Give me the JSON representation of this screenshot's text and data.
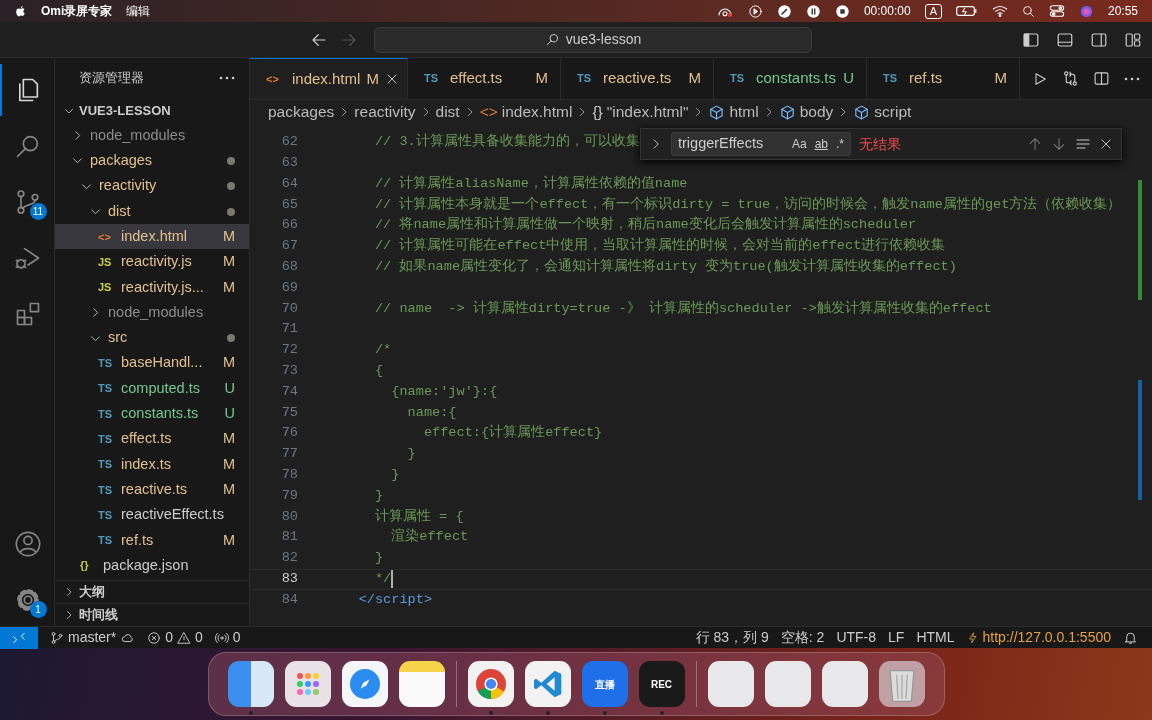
{
  "menubar": {
    "app": "Omi录屏专家",
    "menus": [
      "编辑"
    ],
    "timer": "00:00:00",
    "input_method": "A",
    "clock": "20:55"
  },
  "titlebar": {
    "search": "vue3-lesson"
  },
  "activity_bar": [
    {
      "kind": "explorer",
      "selected": true
    },
    {
      "kind": "search",
      "selected": false
    },
    {
      "kind": "scm",
      "selected": false,
      "badge": "11"
    },
    {
      "kind": "debug",
      "selected": false
    },
    {
      "kind": "extensions",
      "selected": false
    }
  ],
  "activity_bottom": [
    {
      "kind": "account"
    },
    {
      "kind": "settings",
      "badge": "1"
    }
  ],
  "sidebar": {
    "title": "资源管理器",
    "root": {
      "name": "VUE3-LESSON",
      "expanded": true
    },
    "tree": [
      {
        "name": "node_modules",
        "kind": "folder",
        "expanded": false,
        "ignored": true,
        "selected": false
      },
      {
        "name": "packages",
        "kind": "folder",
        "expanded": true,
        "dot": true,
        "selected": false,
        "children": [
          {
            "name": "reactivity",
            "kind": "folder",
            "expanded": true,
            "dot": true,
            "selected": false,
            "children": [
              {
                "name": "dist",
                "kind": "folder",
                "expanded": true,
                "dot": true,
                "selected": false,
                "children": [
                  {
                    "name": "index.html",
                    "kind": "html",
                    "icon": "<>",
                    "badge": "M",
                    "selected": true
                  },
                  {
                    "name": "reactivity.js",
                    "kind": "js",
                    "icon": "JS",
                    "badge": "M",
                    "selected": false
                  },
                  {
                    "name": "reactivity.js...",
                    "kind": "js",
                    "icon": "JS",
                    "badge": "M",
                    "selected": false
                  }
                ]
              },
              {
                "name": "node_modules",
                "kind": "folder",
                "expanded": false,
                "ignored": true,
                "selected": false
              },
              {
                "name": "src",
                "kind": "folder",
                "expanded": true,
                "dot": true,
                "selected": false,
                "children": [
                  {
                    "name": "baseHandl...",
                    "kind": "ts",
                    "icon": "TS",
                    "badge": "M",
                    "selected": false
                  },
                  {
                    "name": "computed.ts",
                    "kind": "ts",
                    "icon": "TS",
                    "badge": "U",
                    "selected": false
                  },
                  {
                    "name": "constants.ts",
                    "kind": "ts",
                    "icon": "TS",
                    "badge": "U",
                    "selected": false
                  },
                  {
                    "name": "effect.ts",
                    "kind": "ts",
                    "icon": "TS",
                    "badge": "M",
                    "selected": false
                  },
                  {
                    "name": "index.ts",
                    "kind": "ts",
                    "icon": "TS",
                    "badge": "M",
                    "selected": false
                  },
                  {
                    "name": "reactive.ts",
                    "kind": "ts",
                    "icon": "TS",
                    "badge": "M",
                    "selected": false
                  },
                  {
                    "name": "reactiveEffect.ts",
                    "kind": "ts",
                    "icon": "TS",
                    "selected": false
                  },
                  {
                    "name": "ref.ts",
                    "kind": "ts",
                    "icon": "TS",
                    "badge": "M",
                    "selected": false
                  }
                ]
              }
            ]
          },
          {
            "name": "package.json",
            "kind": "json",
            "icon": "{}",
            "selected": false
          }
        ]
      }
    ],
    "sections": [
      {
        "name": "大纲",
        "expanded": false
      },
      {
        "name": "时间线",
        "expanded": false
      }
    ]
  },
  "tabs": [
    {
      "name": "index.html",
      "kind": "html",
      "icon": "<>",
      "badge": "M",
      "selected": true
    },
    {
      "name": "effect.ts",
      "kind": "ts",
      "icon": "TS",
      "badge": "M",
      "selected": false
    },
    {
      "name": "reactive.ts",
      "kind": "ts",
      "icon": "TS",
      "badge": "M",
      "selected": false
    },
    {
      "name": "constants.ts",
      "kind": "ts",
      "icon": "TS",
      "badge": "U",
      "selected": false
    },
    {
      "name": "ref.ts",
      "kind": "ts",
      "icon": "TS",
      "badge": "M",
      "selected": false
    }
  ],
  "breadcrumb": [
    {
      "text": "packages",
      "kind": "folder"
    },
    {
      "text": "reactivity",
      "kind": "folder"
    },
    {
      "text": "dist",
      "kind": "folder"
    },
    {
      "text": "index.html",
      "kind": "html",
      "icon": "<>"
    },
    {
      "text": "\"index.html\"",
      "kind": "object",
      "icon": "{}"
    },
    {
      "text": "html",
      "kind": "element"
    },
    {
      "text": "body",
      "kind": "element"
    },
    {
      "text": "script",
      "kind": "element"
    }
  ],
  "find": {
    "value": "triggerEffects",
    "options": [
      "Aa",
      "ab",
      ".*"
    ],
    "result": "无结果"
  },
  "code": [
    {
      "number": "62",
      "text": "      // 3.计算属性具备收集能力的，可以收集",
      "kind": "comment"
    },
    {
      "number": "63"
    },
    {
      "number": "64",
      "text": "      // 计算属性aliasName，计算属性依赖的值name",
      "kind": "comment"
    },
    {
      "number": "65",
      "text": "      // 计算属性本身就是一个effect，有一个标识dirty = true，访问的时候会，触发name属性的get方法（依赖收集）",
      "kind": "comment"
    },
    {
      "number": "66",
      "text": "      // 将name属性和计算属性做一个映射，稍后name变化后会触发计算属性的scheduler",
      "kind": "comment"
    },
    {
      "number": "67",
      "text": "      // 计算属性可能在effect中使用，当取计算属性的时候，会对当前的effect进行依赖收集",
      "kind": "comment"
    },
    {
      "number": "68",
      "text": "      // 如果name属性变化了，会通知计算属性将dirty 变为true(触发计算属性收集的effect)",
      "kind": "comment"
    },
    {
      "number": "69"
    },
    {
      "number": "70",
      "text": "      // name  -> 计算属性dirty=true -》 计算属性的scheduler ->触发计算属性收集的effect",
      "kind": "comment"
    },
    {
      "number": "71"
    },
    {
      "number": "72",
      "text": "      /*",
      "kind": "comment"
    },
    {
      "number": "73",
      "text": "      {",
      "kind": "comment"
    },
    {
      "number": "74",
      "text": "        {name:'jw'}:{",
      "kind": "comment"
    },
    {
      "number": "75",
      "text": "          name:{",
      "kind": "comment"
    },
    {
      "number": "76",
      "text": "            effect:{计算属性effect}",
      "kind": "comment"
    },
    {
      "number": "77",
      "text": "          }",
      "kind": "comment"
    },
    {
      "number": "78",
      "text": "        }",
      "kind": "comment"
    },
    {
      "number": "79",
      "text": "      }",
      "kind": "comment"
    },
    {
      "number": "80",
      "text": "      计算属性 = {",
      "kind": "comment"
    },
    {
      "number": "81",
      "text": "        渲染effect",
      "kind": "comment"
    },
    {
      "number": "82",
      "text": "      }",
      "kind": "comment"
    },
    {
      "number": "83",
      "text": "      */",
      "kind": "comment",
      "current": true
    },
    {
      "number": "84",
      "text": "    </script>",
      "kind": "tag"
    }
  ],
  "status_bar": {
    "branch": "master*",
    "errors": "0",
    "warnings": "0",
    "ports": "0",
    "items": [
      "行 83，列 9",
      "空格: 2",
      "UTF-8",
      "LF",
      "HTML"
    ],
    "live_server": "http://127.0.0.1:5500"
  },
  "dock": [
    {
      "kind": "finder",
      "running": true
    },
    {
      "kind": "launchpad",
      "running": false
    },
    {
      "kind": "safari",
      "running": false
    },
    {
      "kind": "notes",
      "running": false
    },
    {
      "kind": "separator"
    },
    {
      "kind": "chrome",
      "running": true
    },
    {
      "kind": "vscode",
      "running": true
    },
    {
      "kind": "live",
      "running": true,
      "text": "直播"
    },
    {
      "kind": "rec",
      "running": true,
      "text": "REC"
    },
    {
      "kind": "separator"
    },
    {
      "kind": "thumbnail",
      "running": false
    },
    {
      "kind": "thumbnail",
      "running": false
    },
    {
      "kind": "thumbnail",
      "running": false
    },
    {
      "kind": "trash",
      "running": false
    }
  ]
}
